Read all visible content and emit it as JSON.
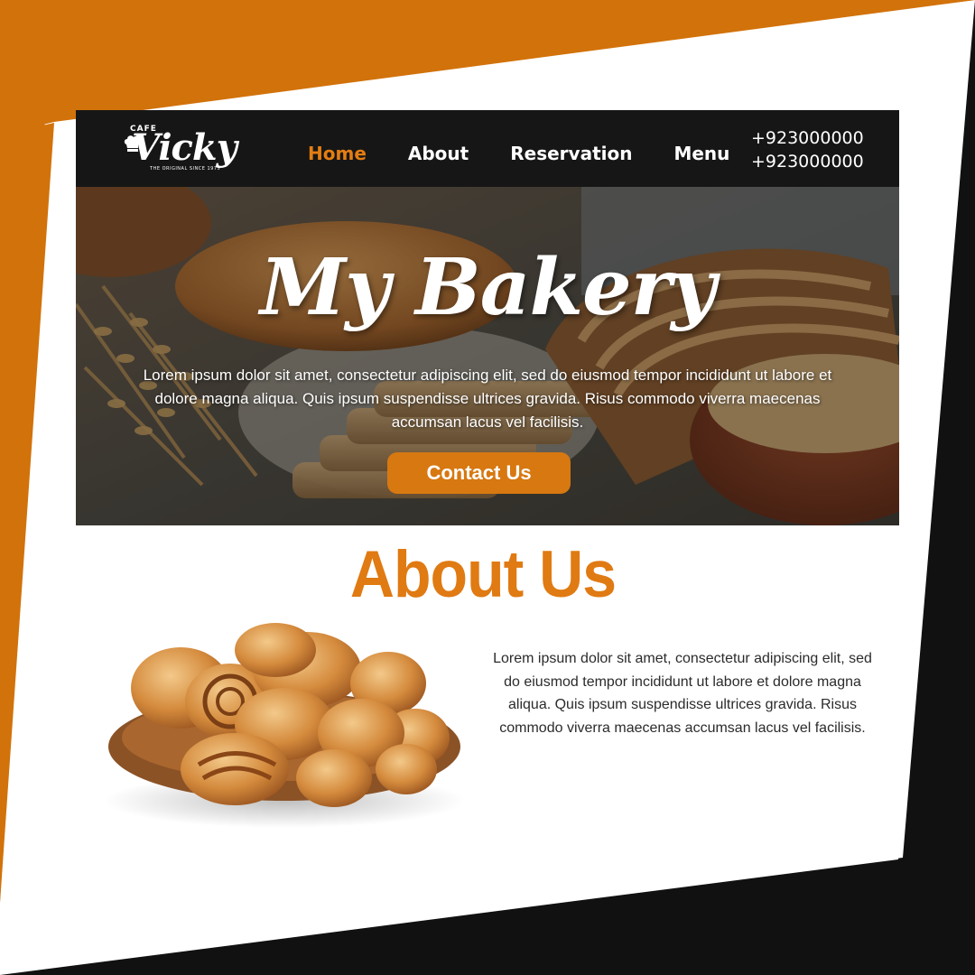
{
  "brand": {
    "logo_small": "CAFE",
    "logo_main": "Vicky",
    "logo_tagline": "THE ORIGINAL SINCE 1975"
  },
  "nav": {
    "items": [
      {
        "label": "Home",
        "active": true
      },
      {
        "label": "About",
        "active": false
      },
      {
        "label": "Reservation",
        "active": false
      },
      {
        "label": "Menu",
        "active": false
      }
    ]
  },
  "contact": {
    "phone_1": "+923000000",
    "phone_2": "+923000000"
  },
  "hero": {
    "title": "My Bakery",
    "text": "Lorem ipsum dolor sit amet, consectetur adipiscing elit, sed do eiusmod tempor incididunt ut labore et dolore magna aliqua. Quis ipsum suspendisse ultrices gravida. Risus commodo viverra maecenas accumsan lacus vel facilisis.",
    "button_label": "Contact Us"
  },
  "about": {
    "title": "About Us",
    "text": "Lorem ipsum dolor sit amet, consectetur adipiscing elit, sed do eiusmod tempor incididunt ut labore et dolore magna aliqua. Quis ipsum suspendisse ultrices gravida. Risus commodo viverra maecenas accumsan lacus vel facilisis."
  },
  "colors": {
    "accent": "#e07a12",
    "header_bg": "#161616",
    "frame_dark": "#111111",
    "page_bg": "#ffffff"
  },
  "icons": {
    "logo_mark": "chef-hat-icon"
  }
}
